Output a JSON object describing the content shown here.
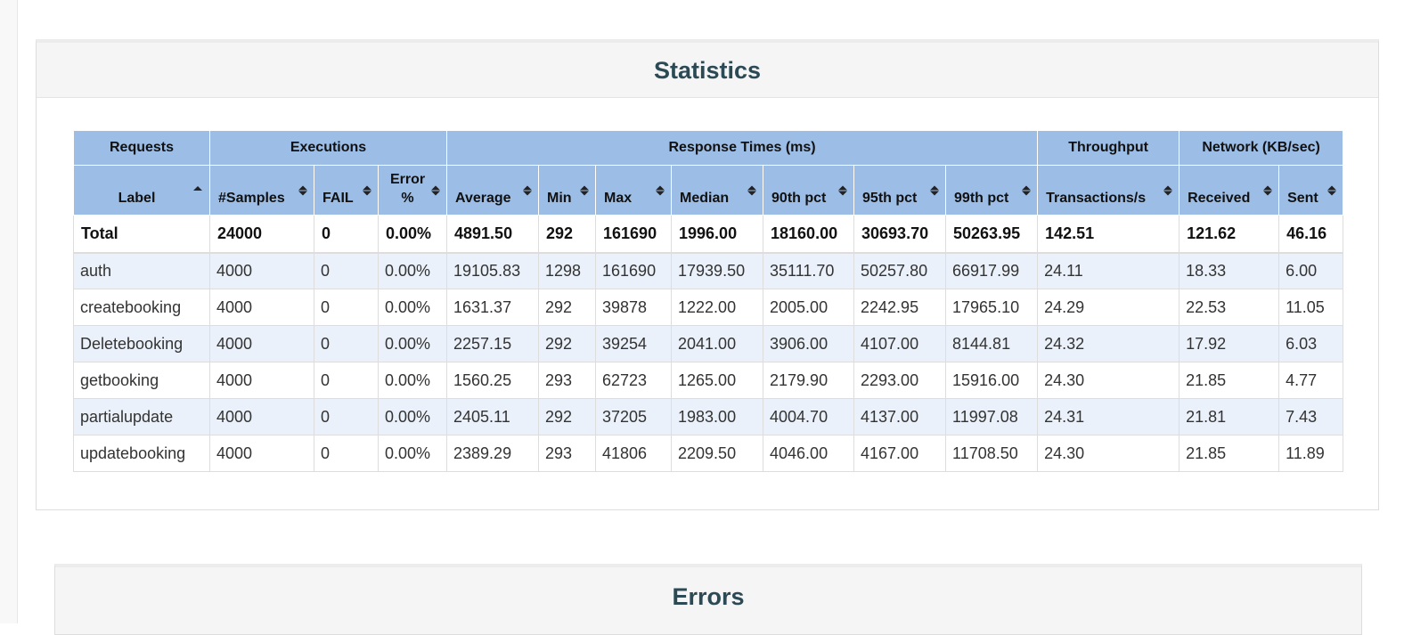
{
  "statistics": {
    "title": "Statistics",
    "groups": [
      "Requests",
      "Executions",
      "Response Times (ms)",
      "Throughput",
      "Network (KB/sec)"
    ],
    "columns": [
      "Label",
      "#Samples",
      "FAIL",
      "Error %",
      "Average",
      "Min",
      "Max",
      "Median",
      "90th pct",
      "95th pct",
      "99th pct",
      "Transactions/s",
      "Received",
      "Sent"
    ],
    "total": [
      "Total",
      "24000",
      "0",
      "0.00%",
      "4891.50",
      "292",
      "161690",
      "1996.00",
      "18160.00",
      "30693.70",
      "50263.95",
      "142.51",
      "121.62",
      "46.16"
    ],
    "rows": [
      [
        "auth",
        "4000",
        "0",
        "0.00%",
        "19105.83",
        "1298",
        "161690",
        "17939.50",
        "35111.70",
        "50257.80",
        "66917.99",
        "24.11",
        "18.33",
        "6.00"
      ],
      [
        "createbooking",
        "4000",
        "0",
        "0.00%",
        "1631.37",
        "292",
        "39878",
        "1222.00",
        "2005.00",
        "2242.95",
        "17965.10",
        "24.29",
        "22.53",
        "11.05"
      ],
      [
        "Deletebooking",
        "4000",
        "0",
        "0.00%",
        "2257.15",
        "292",
        "39254",
        "2041.00",
        "3906.00",
        "4107.00",
        "8144.81",
        "24.32",
        "17.92",
        "6.03"
      ],
      [
        "getbooking",
        "4000",
        "0",
        "0.00%",
        "1560.25",
        "293",
        "62723",
        "1265.00",
        "2179.90",
        "2293.00",
        "15916.00",
        "24.30",
        "21.85",
        "4.77"
      ],
      [
        "partialupdate",
        "4000",
        "0",
        "0.00%",
        "2405.11",
        "292",
        "37205",
        "1983.00",
        "4004.70",
        "4137.00",
        "11997.08",
        "24.31",
        "21.81",
        "7.43"
      ],
      [
        "updatebooking",
        "4000",
        "0",
        "0.00%",
        "2389.29",
        "293",
        "41806",
        "2209.50",
        "4046.00",
        "4167.00",
        "11708.50",
        "24.30",
        "21.85",
        "11.89"
      ]
    ]
  },
  "errors": {
    "title": "Errors"
  }
}
